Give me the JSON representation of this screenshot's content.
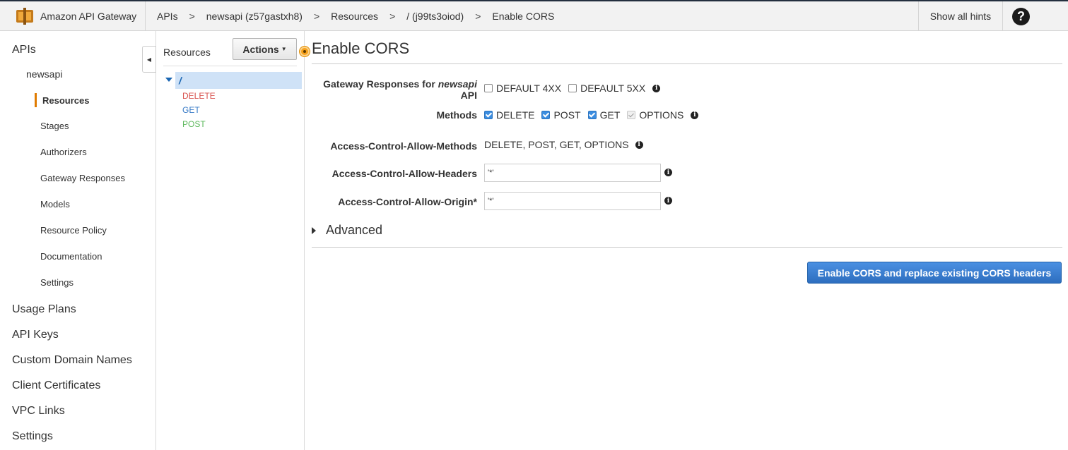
{
  "header": {
    "app_name": "Amazon API Gateway",
    "breadcrumb": [
      "APIs",
      "newsapi (z57gastxh8)",
      "Resources",
      "/ (j99ts3oiod)",
      "Enable CORS"
    ],
    "breadcrumb_separator": ">",
    "show_hints_label": "Show all hints",
    "help_label": "?"
  },
  "sidebar": {
    "apis_label": "APIs",
    "api_name": "newsapi",
    "api_items": [
      "Resources",
      "Stages",
      "Authorizers",
      "Gateway Responses",
      "Models",
      "Resource Policy",
      "Documentation",
      "Settings"
    ],
    "active_item": "Resources",
    "bottom_items": [
      "Usage Plans",
      "API Keys",
      "Custom Domain Names",
      "Client Certificates",
      "VPC Links",
      "Settings"
    ]
  },
  "resources": {
    "title": "Resources",
    "actions_label": "Actions",
    "root_path": "/",
    "methods": [
      {
        "name": "DELETE",
        "color": "#d9534f"
      },
      {
        "name": "GET",
        "color": "#3a7cc7"
      },
      {
        "name": "POST",
        "color": "#5cb85c"
      }
    ]
  },
  "cors": {
    "title": "Enable CORS",
    "gateway_responses_label_prefix": "Gateway Responses for",
    "gateway_responses_api": "newsapi",
    "gateway_responses_label_suffix": "API",
    "gateway_options": [
      {
        "label": "DEFAULT 4XX",
        "checked": false
      },
      {
        "label": "DEFAULT 5XX",
        "checked": false
      }
    ],
    "methods_label": "Methods",
    "method_options": [
      {
        "label": "DELETE",
        "checked": true
      },
      {
        "label": "POST",
        "checked": true
      },
      {
        "label": "GET",
        "checked": true
      },
      {
        "label": "OPTIONS",
        "checked": true,
        "disabled": true
      }
    ],
    "allow_methods_label": "Access-Control-Allow-Methods",
    "allow_methods_value": "DELETE, POST, GET, OPTIONS",
    "allow_headers_label": "Access-Control-Allow-Headers",
    "allow_headers_value": "'*'",
    "allow_origin_label": "Access-Control-Allow-Origin*",
    "allow_origin_value": "'*'",
    "advanced_label": "Advanced",
    "submit_label": "Enable CORS and replace existing CORS headers"
  },
  "colors": {
    "accent_orange": "#e07b00",
    "primary_blue": "#2e6ebf"
  }
}
